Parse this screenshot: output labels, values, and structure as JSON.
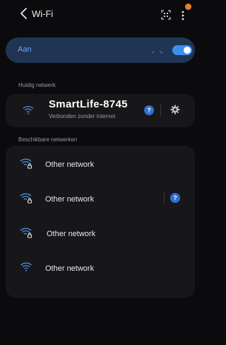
{
  "header": {
    "title": "Wi-Fi",
    "back_icon": "chevron-left-icon",
    "qr_icon": "qr-scan-icon",
    "more_icon": "more-vertical-icon",
    "notification_dot_color": "#e6812b"
  },
  "wifi_toggle": {
    "label": "Aan",
    "state": "on",
    "accent_color": "#3e8ef0",
    "scanning_glyph": "⸝ ⸜"
  },
  "current_network": {
    "section_label": "Huidig netwerk",
    "name": "SmartLife-8745",
    "status": "Verbonden zonder internet",
    "help_label": "?",
    "icons": [
      "wifi-icon",
      "help-icon",
      "gear-icon"
    ]
  },
  "available_networks": {
    "section_label": "Beschikbare netwerken",
    "items": [
      {
        "name": "Other network",
        "secured": true,
        "has_help": false
      },
      {
        "name": "Other network",
        "secured": true,
        "has_help": true,
        "help_label": "?"
      },
      {
        "name": "Other network",
        "secured": true,
        "has_help": false
      },
      {
        "name": "Other network",
        "secured": false,
        "has_help": false
      }
    ]
  }
}
